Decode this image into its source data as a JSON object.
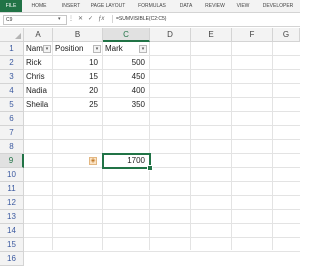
{
  "ribbon": {
    "tabs": [
      "FILE",
      "HOME",
      "INSERT",
      "PAGE LAYOUT",
      "FORMULAS",
      "DATA",
      "REVIEW",
      "VIEW",
      "DEVELOPER"
    ]
  },
  "formula_bar": {
    "name_box": "C9",
    "formula": "=SUMVISIBLE(C2:C5)"
  },
  "sheet": {
    "columns": [
      "A",
      "B",
      "C",
      "D",
      "E",
      "F",
      "G"
    ],
    "rows": [
      "1",
      "2",
      "3",
      "4",
      "5",
      "6",
      "7",
      "8",
      "9",
      "10",
      "11",
      "12",
      "13",
      "14",
      "15",
      "16"
    ],
    "headers": {
      "name": "Name",
      "position": "Position",
      "mark": "Mark"
    },
    "data": [
      {
        "name": "Rick",
        "position": "10",
        "mark": "500"
      },
      {
        "name": "Chris",
        "position": "15",
        "mark": "450"
      },
      {
        "name": "Nadia",
        "position": "20",
        "mark": "400"
      },
      {
        "name": "Sheila",
        "position": "25",
        "mark": "350"
      }
    ],
    "result": "1700",
    "active_cell": "C9"
  },
  "colors": {
    "accent": "#217346",
    "row_header_text": "#3c5aa0"
  }
}
